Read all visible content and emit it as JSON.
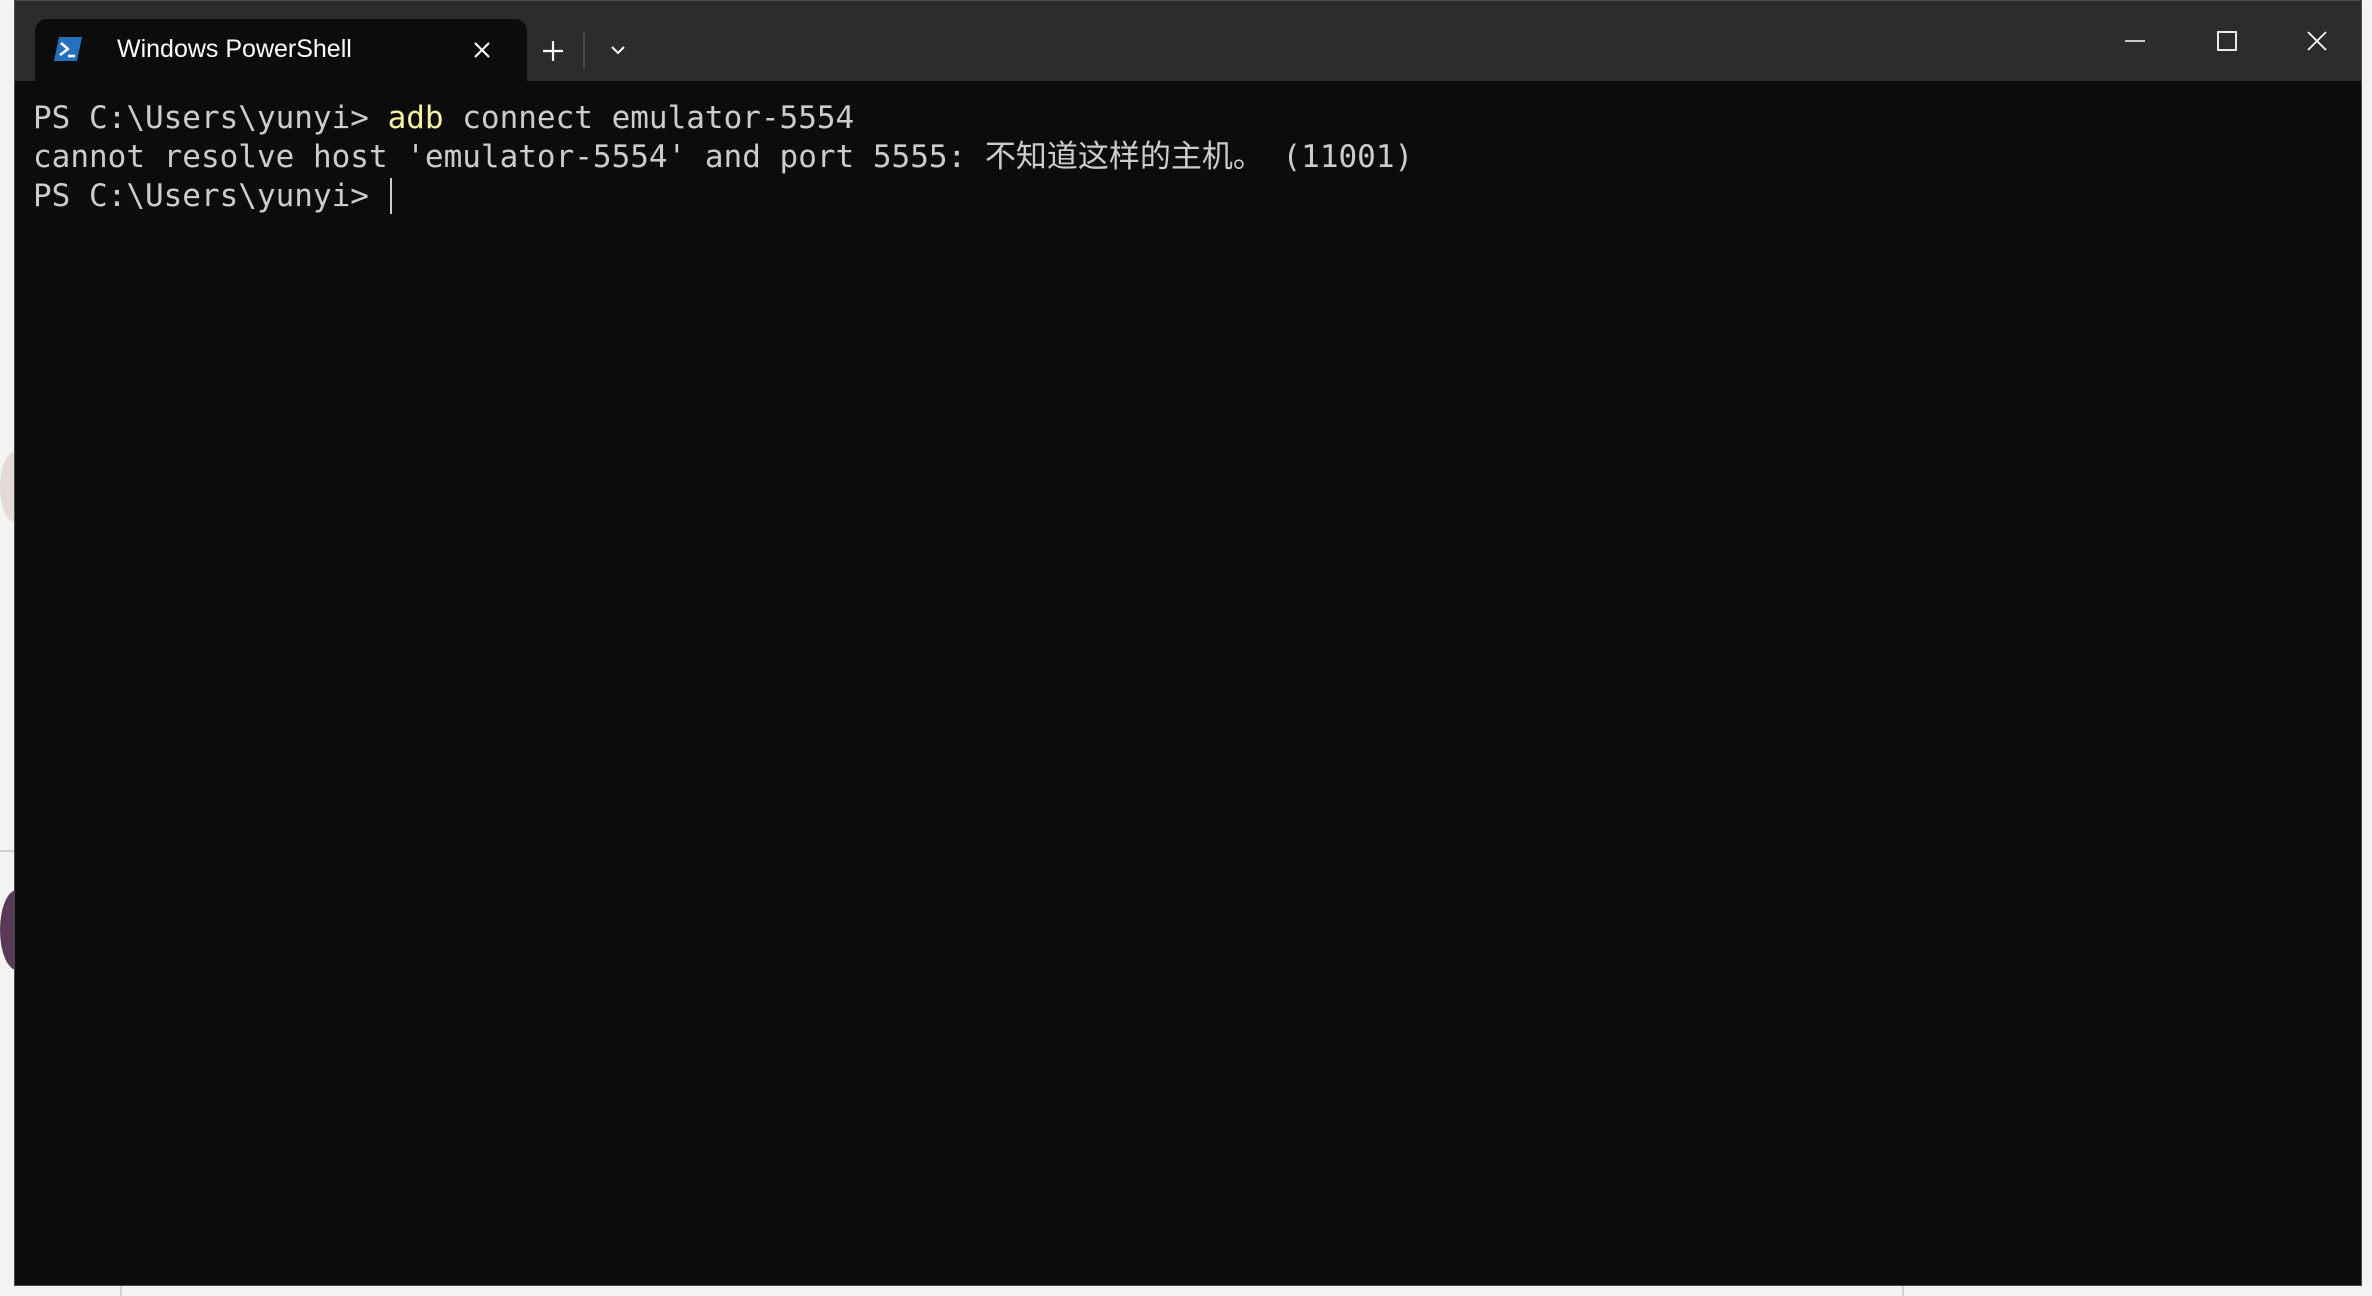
{
  "window": {
    "tab_title": "Windows PowerShell",
    "tab_icon": "powershell-icon",
    "new_tab_icon": "plus-icon",
    "dropdown_icon": "chevron-down-icon",
    "minimize_icon": "minimize-icon",
    "maximize_icon": "maximize-icon",
    "close_icon": "close-icon"
  },
  "terminal": {
    "line1_prompt": "PS C:\\Users\\yunyi> ",
    "line1_command": "adb",
    "line1_args": " connect emulator-5554",
    "line2_output": "cannot resolve host 'emulator-5554' and port 5555: 不知道这样的主机。 (11001)",
    "line3_prompt": "PS C:\\Users\\yunyi> "
  },
  "colors": {
    "terminal_bg": "#0c0c0c",
    "titlebar_bg": "#2c2c2c",
    "text": "#cccccc",
    "command_highlight": "#f9f1a5",
    "powershell_blue": "#2671be"
  }
}
